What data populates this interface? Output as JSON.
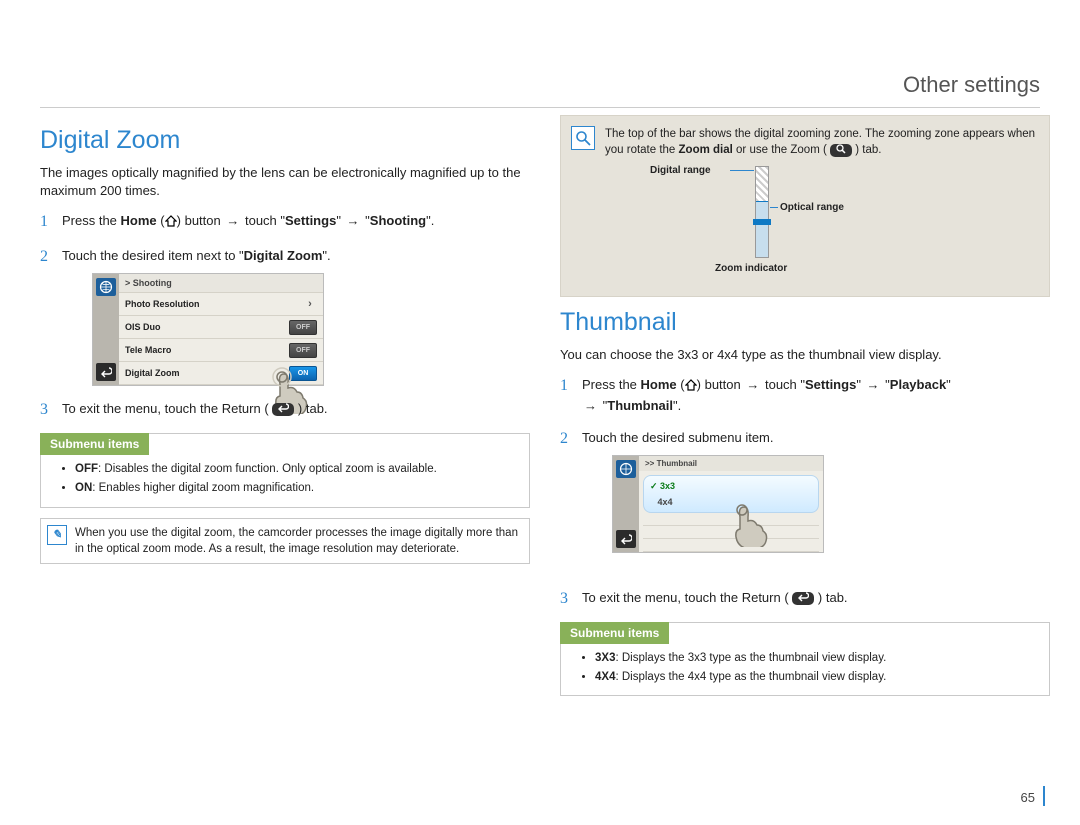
{
  "page": {
    "header": "Other settings",
    "number": "65"
  },
  "left": {
    "title": "Digital Zoom",
    "intro": "The images optically magnified by the lens can be electronically magnified up to the maximum 200 times.",
    "steps": {
      "s1_a": "Press the ",
      "s1_home": "Home",
      "s1_b": " button ",
      "s1_c": " touch \"",
      "s1_settings": "Settings",
      "s1_d": "\" ",
      "s1_e": " \"",
      "s1_shooting": "Shooting",
      "s1_f": "\".",
      "s2_a": "Touch the desired item next to \"",
      "s2_b": "Digital Zoom",
      "s2_c": "\".",
      "s3_a": "To exit the menu, touch the Return (",
      "s3_b": ") tab."
    },
    "device": {
      "header": ">  Shooting",
      "rows": [
        {
          "label": "Photo Resolution",
          "widget": "chev"
        },
        {
          "label": "OIS Duo",
          "widget": "off"
        },
        {
          "label": "Tele Macro",
          "widget": "off"
        },
        {
          "label": "Digital Zoom",
          "widget": "on"
        }
      ],
      "off_label": "OFF",
      "on_label": "ON"
    },
    "submenu": {
      "title": "Submenu items",
      "items": [
        {
          "b": "OFF",
          "t": ": Disables the digital zoom function. Only optical zoom is available."
        },
        {
          "b": "ON",
          "t": ": Enables higher digital zoom magnification."
        }
      ]
    },
    "note": "When you use the digital zoom, the camcorder processes the image digitally more than in the optical zoom mode. As a result, the image resolution may deteriorate."
  },
  "right": {
    "info": {
      "text_a": "The top of the bar shows the digital zooming zone. The zooming zone appears when you rotate the ",
      "text_b": "Zoom dial",
      "text_c": " or use the Zoom (",
      "text_d": ") tab.",
      "digital": "Digital range",
      "optical": "Optical range",
      "indicator": "Zoom indicator"
    },
    "title": "Thumbnail",
    "intro": "You can choose the 3x3 or 4x4 type as the thumbnail view display.",
    "steps": {
      "s1_a": "Press the ",
      "s1_home": "Home",
      "s1_b": " button ",
      "s1_c": " touch \"",
      "s1_settings": "Settings",
      "s1_d": "\" ",
      "s1_e": " \"",
      "s1_playback": "Playback",
      "s1_f": "\" ",
      "s1_g": " \"",
      "s1_thumb": "Thumbnail",
      "s1_h": "\".",
      "s2": "Touch the desired submenu item.",
      "s3_a": "To exit the menu, touch the Return (",
      "s3_b": ") tab."
    },
    "device": {
      "header": ">> Thumbnail",
      "sel": "3x3",
      "opt": "4x4"
    },
    "submenu": {
      "title": "Submenu items",
      "items": [
        {
          "b": "3X3",
          "t": ": Displays the 3x3 type as the thumbnail view display."
        },
        {
          "b": "4X4",
          "t": ": Displays the 4x4 type as the thumbnail view display."
        }
      ]
    }
  }
}
